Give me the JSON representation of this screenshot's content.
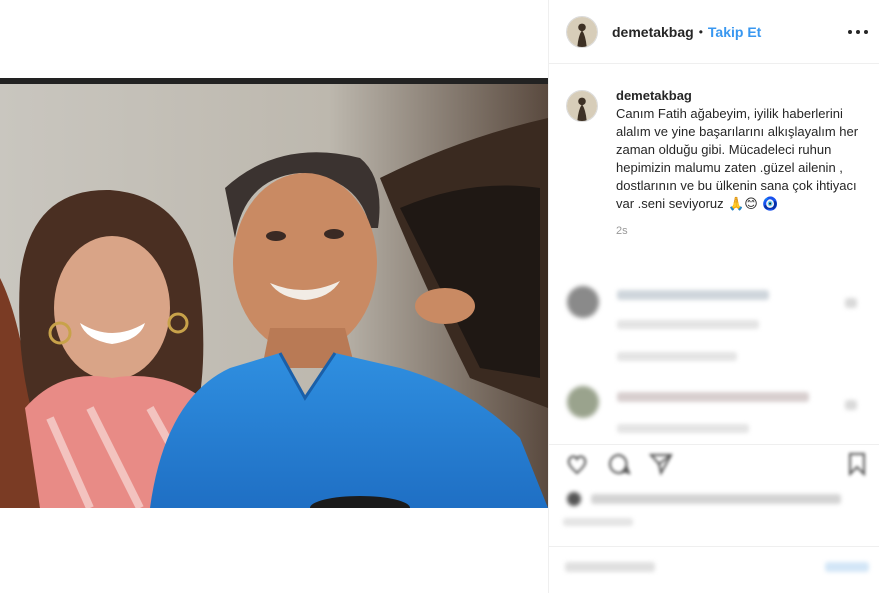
{
  "post": {
    "username": "demetakbag",
    "separator": "•",
    "follow_label": "Takip Et",
    "caption_user": "demetakbag",
    "caption_text": "Canım Fatih ağabeyim, iyilik haberlerini alalım ve yine başarılarını alkışlayalım her zaman olduğu gibi. Mücadeleci ruhun hepimizin malumu zaten .güzel ailenin , dostlarının ve bu ülkenin sana çok ihtiyacı var .seni seviyoruz",
    "caption_emojis": "🙏😊 🧿",
    "time": "2s"
  },
  "icons": {
    "more": "more-options-icon",
    "like": "heart-icon",
    "comment": "comment-icon",
    "share": "share-icon",
    "save": "bookmark-icon"
  },
  "colors": {
    "accent": "#3897f0",
    "text": "#262626",
    "muted": "#999999",
    "border": "#efefef"
  }
}
